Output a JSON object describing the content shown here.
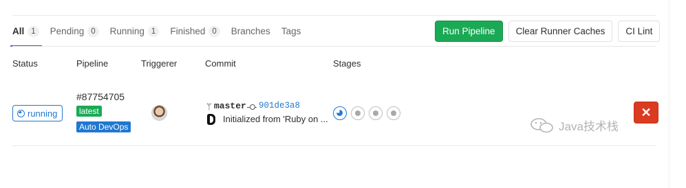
{
  "tabs": [
    {
      "label": "All",
      "count": "1"
    },
    {
      "label": "Pending",
      "count": "0"
    },
    {
      "label": "Running",
      "count": "1"
    },
    {
      "label": "Finished",
      "count": "0"
    },
    {
      "label": "Branches"
    },
    {
      "label": "Tags"
    }
  ],
  "actions": {
    "run_pipeline": "Run Pipeline",
    "clear_runner_caches": "Clear Runner Caches",
    "ci_lint": "CI Lint"
  },
  "table": {
    "headers": [
      "Status",
      "Pipeline",
      "Triggerer",
      "Commit",
      "Stages"
    ],
    "rows": [
      {
        "status": "running",
        "pipeline_id": "#87754705",
        "labels": [
          "latest",
          "Auto DevOps"
        ],
        "commit": {
          "branch": "master",
          "sha": "901de3a8",
          "message": "Initialized from 'Ruby on ..."
        },
        "stages": [
          "running",
          "pending",
          "pending",
          "pending"
        ]
      }
    ]
  },
  "watermark": "Java技术栈",
  "colors": {
    "accent": "#6b4fbb",
    "success": "#1aaa55",
    "info": "#1f78d1",
    "danger": "#db3b21"
  }
}
